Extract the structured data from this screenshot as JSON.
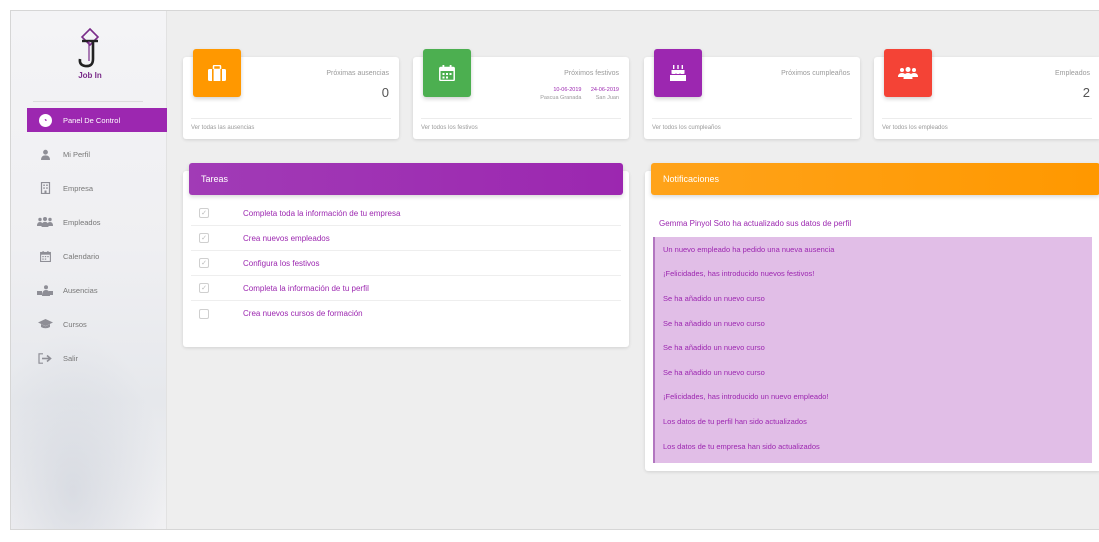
{
  "brand": {
    "name": "Job In"
  },
  "sidebar": {
    "items": [
      {
        "label": "Panel De Control",
        "icon": "dashboard-icon",
        "active": true
      },
      {
        "label": "Mi Perfil",
        "icon": "user-icon"
      },
      {
        "label": "Empresa",
        "icon": "building-icon"
      },
      {
        "label": "Empleados",
        "icon": "group-icon"
      },
      {
        "label": "Calendario",
        "icon": "calendar-icon"
      },
      {
        "label": "Ausencias",
        "icon": "absence-icon"
      },
      {
        "label": "Cursos",
        "icon": "graduation-cap-icon"
      },
      {
        "label": "Salir",
        "icon": "exit-icon"
      }
    ]
  },
  "cards": {
    "ausencias": {
      "title": "Próximas ausencias",
      "value": "0",
      "link": "Ver todas las ausencias",
      "color": "#ff9800",
      "icon": "briefcase-icon"
    },
    "festivos": {
      "title": "Próximos festivos",
      "link": "Ver todos los festivos",
      "color": "#4caf50",
      "icon": "calendar-icon",
      "items": [
        {
          "date": "10-06-2019",
          "name": "Pascua Granada"
        },
        {
          "date": "24-06-2019",
          "name": "San Juan"
        }
      ]
    },
    "cumpleanos": {
      "title": "Próximos cumpleaños",
      "link": "Ver todos los cumpleaños",
      "color": "#9c27b0",
      "icon": "birthday-cake-icon"
    },
    "empleados": {
      "title": "Empleados",
      "value": "2",
      "link": "Ver todos los empleados",
      "color": "#f44336",
      "icon": "users-icon"
    }
  },
  "tasks": {
    "title": "Tareas",
    "header_color": "#9c27b0",
    "items": [
      {
        "label": "Completa toda la información de tu empresa",
        "done": true
      },
      {
        "label": "Crea nuevos empleados",
        "done": true
      },
      {
        "label": "Configura los festivos",
        "done": true
      },
      {
        "label": "Completa la información de tu perfil",
        "done": true
      },
      {
        "label": "Crea nuevos cursos de formación",
        "done": false
      }
    ]
  },
  "notifications": {
    "title": "Notificaciones",
    "header_color": "#ff9800",
    "first": "Gemma Pinyol Soto ha actualizado sus datos de perfil",
    "items": [
      "Un nuevo empleado ha pedido una nueva ausencia",
      "¡Felicidades, has introducido nuevos festivos!",
      "Se ha añadido un nuevo curso",
      "Se ha añadido un nuevo curso",
      "Se ha añadido un nuevo curso",
      "Se ha añadido un nuevo curso",
      "¡Felicidades, has introducido un nuevo empleado!",
      "Los datos de tu perfil han sido actualizados",
      "Los datos de tu empresa han sido actualizados"
    ]
  }
}
